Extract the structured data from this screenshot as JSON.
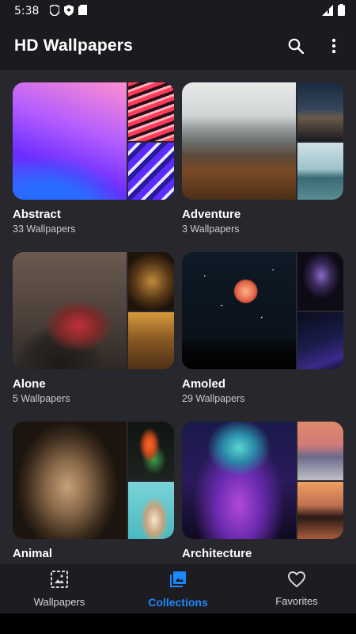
{
  "status_bar": {
    "time": "5:38"
  },
  "app_bar": {
    "title": "HD Wallpapers",
    "search_icon": "search-icon",
    "menu_icon": "more-vert-icon"
  },
  "collections": [
    {
      "title": "Abstract",
      "count": "33 Wallpapers"
    },
    {
      "title": "Adventure",
      "count": "3 Wallpapers"
    },
    {
      "title": "Alone",
      "count": "5 Wallpapers"
    },
    {
      "title": "Amoled",
      "count": "29 Wallpapers"
    },
    {
      "title": "Animal",
      "count": ""
    },
    {
      "title": "Architecture",
      "count": ""
    }
  ],
  "bottom_nav": {
    "items": [
      {
        "label": "Wallpapers",
        "icon": "image-icon"
      },
      {
        "label": "Collections",
        "icon": "collections-icon"
      },
      {
        "label": "Favorites",
        "icon": "heart-icon"
      }
    ],
    "active": "Collections"
  },
  "colors": {
    "accent": "#1e88ff",
    "background": "#27272d",
    "bar": "#1b1b1f"
  }
}
